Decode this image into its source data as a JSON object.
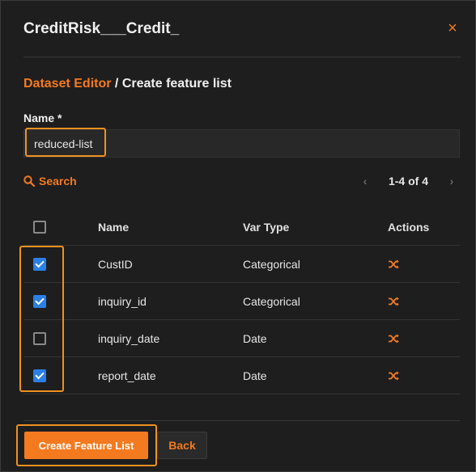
{
  "dialog": {
    "title": "CreditRisk___Credit_",
    "close_glyph": "×"
  },
  "breadcrumb": {
    "link": "Dataset Editor",
    "separator": " / ",
    "current": "Create feature list"
  },
  "name_field": {
    "label": "Name *",
    "value": "reduced-list"
  },
  "search": {
    "label": "Search",
    "icon": "search-icon"
  },
  "pager": {
    "prev": "‹",
    "info": "1-4 of 4",
    "next": "›"
  },
  "table": {
    "columns": [
      "Name",
      "Var Type",
      "Actions"
    ],
    "rows": [
      {
        "name": "CustID",
        "var_type": "Categorical",
        "checked": true
      },
      {
        "name": "inquiry_id",
        "var_type": "Categorical",
        "checked": true
      },
      {
        "name": "inquiry_date",
        "var_type": "Date",
        "checked": false
      },
      {
        "name": "report_date",
        "var_type": "Date",
        "checked": true
      }
    ],
    "action_icon": "shuffle-icon"
  },
  "footer": {
    "create_label": "Create Feature List",
    "back_label": "Back"
  },
  "colors": {
    "accent": "#f47a20",
    "highlight": "#f0911f",
    "checkbox": "#2a80e6",
    "background": "#1e1e1e"
  }
}
